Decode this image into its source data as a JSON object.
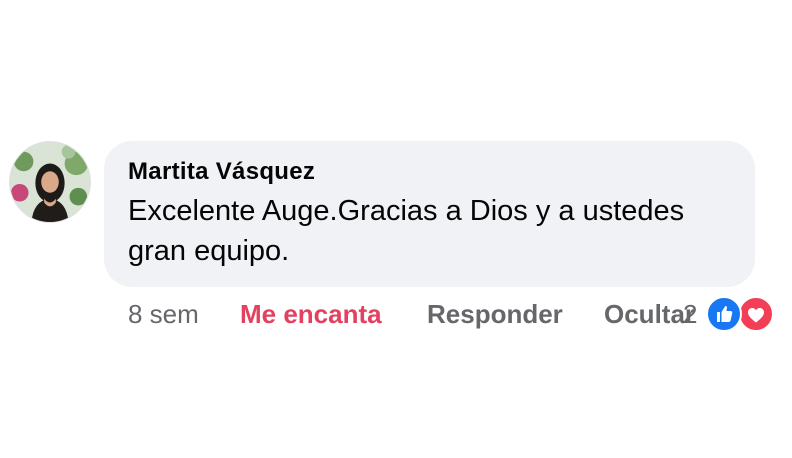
{
  "comment": {
    "author": "Martita Vásquez",
    "text": "Excelente Auge.Gracias a Dios y a ustedes gran equipo.",
    "time": "8 sem",
    "actions": {
      "love_label": "Me encanta",
      "reply_label": "Responder",
      "hide_label": "Ocultar"
    },
    "reaction_count": "2",
    "reactions": [
      "like-icon",
      "love-icon"
    ],
    "colors": {
      "love_action": "#e4405f",
      "like_reaction": "#1877f2",
      "love_reaction": "#f33e58",
      "bubble": "#f0f2f5",
      "muted_text": "#65676b"
    }
  }
}
